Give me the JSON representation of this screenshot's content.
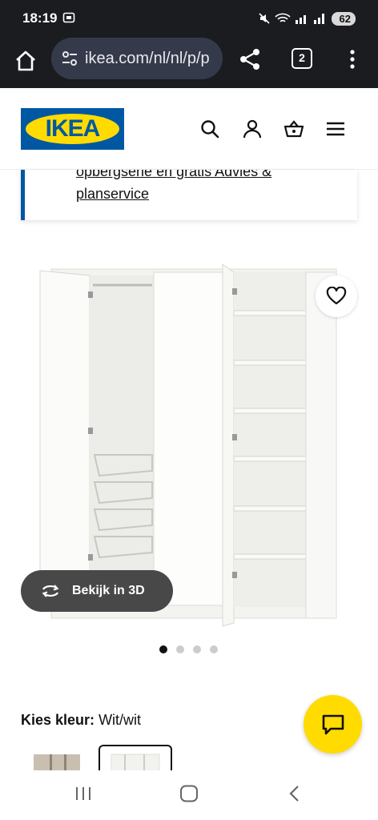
{
  "status": {
    "time": "18:19",
    "battery": "62"
  },
  "browser": {
    "url": "ikea.com/nl/nl/p/p",
    "tab_count": "2"
  },
  "site": {
    "logo_text": "IKEA",
    "brand_blue": "#0058a3",
    "brand_yellow": "#ffdb00"
  },
  "info_banner": {
    "line1": "opbergserie en gratis Advies &",
    "line2": "planservice"
  },
  "gallery": {
    "view_3d_label": "Bekijk in 3D",
    "image_count": 4,
    "active_index": 0
  },
  "color_selector": {
    "label": "Kies kleur:",
    "value": "Wit/wit"
  }
}
